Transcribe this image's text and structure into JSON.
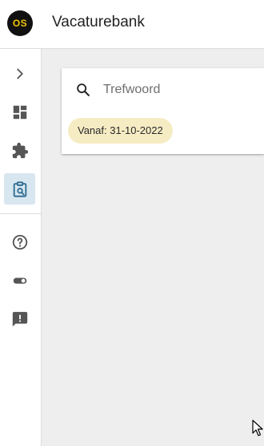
{
  "app": {
    "logo_text": "OS",
    "title": "Vacaturebank"
  },
  "sidebar": {
    "items": [
      {
        "icon": "chevron-right-icon"
      },
      {
        "icon": "dashboard-icon"
      },
      {
        "icon": "puzzle-icon"
      },
      {
        "icon": "clipboard-search-icon",
        "active": true
      },
      {
        "icon": "help-icon"
      },
      {
        "icon": "toggle-icon"
      },
      {
        "icon": "feedback-icon"
      }
    ]
  },
  "search": {
    "placeholder": "Trefwoord",
    "value": ""
  },
  "filters": {
    "date_chip_label": "Vanaf: 31-10-2022"
  },
  "colors": {
    "logo_bg": "#111111",
    "logo_text": "#f2c200",
    "active_nav_bg": "#d8e6f0",
    "chip_bg": "#f6ecc4",
    "content_bg": "#eeeeee",
    "icon_gray": "#555555",
    "icon_active": "#2d6a8f"
  }
}
